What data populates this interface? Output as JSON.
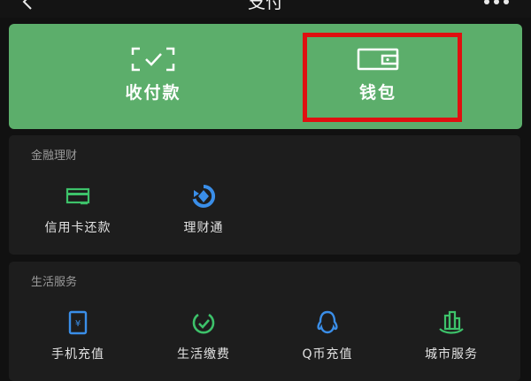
{
  "nav": {
    "title": "支付"
  },
  "pay": {
    "items": [
      {
        "label": "收付款",
        "icon": "scan-pay-icon"
      },
      {
        "label": "钱包",
        "icon": "wallet-icon"
      }
    ]
  },
  "finance": {
    "title": "金融理财",
    "items": [
      {
        "label": "信用卡还款",
        "icon": "credit-card-icon"
      },
      {
        "label": "理财通",
        "icon": "wealth-icon"
      }
    ]
  },
  "life": {
    "title": "生活服务",
    "items": [
      {
        "label": "手机充值",
        "icon": "phone-topup-icon"
      },
      {
        "label": "生活缴费",
        "icon": "utility-bill-icon"
      },
      {
        "label": "Q币充值",
        "icon": "qq-coin-icon"
      },
      {
        "label": "城市服务",
        "icon": "city-services-icon"
      }
    ]
  },
  "colors": {
    "brand_green": "#5cae6b",
    "highlight_red": "#e01010",
    "icon_green": "#3dc26a",
    "icon_blue": "#3a8ee8"
  }
}
